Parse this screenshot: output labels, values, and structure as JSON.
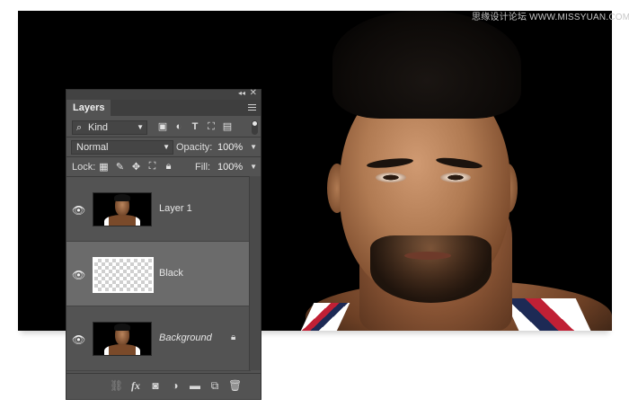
{
  "watermark": "思缘设计论坛 WWW.MISSYUAN.COM",
  "panel": {
    "title": "Layers",
    "collapse_glyph": "◂◂",
    "close_glyph": "✕"
  },
  "filter": {
    "kind_label": "Kind",
    "icons": [
      "pixel-filter-icon",
      "adjustment-filter-icon",
      "type-filter-icon",
      "shape-filter-icon",
      "smart-object-filter-icon"
    ]
  },
  "blend": {
    "mode": "Normal",
    "opacity_label": "Opacity:",
    "opacity_value": "100%"
  },
  "lock": {
    "label": "Lock:",
    "fill_label": "Fill:",
    "fill_value": "100%"
  },
  "layers": [
    {
      "name": "Layer 1",
      "visible": true,
      "selected": false,
      "thumbnail": "photo"
    },
    {
      "name": "Black",
      "visible": true,
      "selected": true,
      "thumbnail": "transparent"
    },
    {
      "name": "Background",
      "visible": true,
      "selected": false,
      "thumbnail": "photo",
      "locked": true
    }
  ],
  "bottom_bar": [
    "link-layers-icon",
    "fx-icon",
    "add-mask-icon",
    "new-adjustment-icon",
    "new-group-icon",
    "new-layer-icon",
    "delete-icon"
  ],
  "colors": {
    "panel_bg": "#535353",
    "selected_row": "#6b6b6b",
    "canvas_bg": "#000000"
  }
}
